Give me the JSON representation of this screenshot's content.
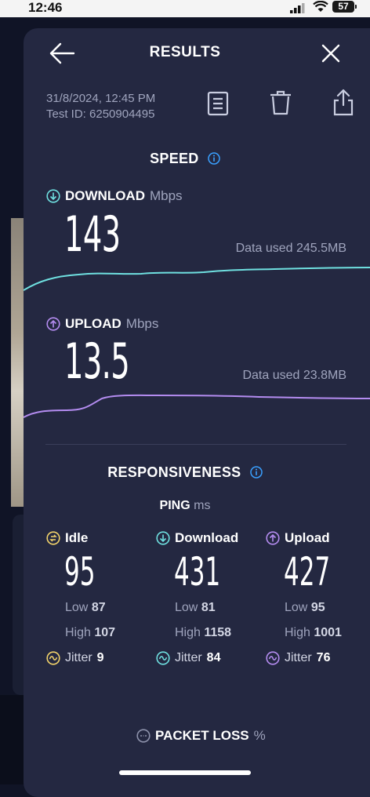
{
  "status": {
    "time": "12:46",
    "battery": "57"
  },
  "header": {
    "title": "RESULTS"
  },
  "meta": {
    "datetime": "31/8/2024, 12:45 PM",
    "test_id": "Test ID: 6250904495"
  },
  "speed": {
    "title": "SPEED",
    "download": {
      "label": "DOWNLOAD",
      "unit": "Mbps",
      "value": "143",
      "data_used": "Data used 245.5MB"
    },
    "upload": {
      "label": "UPLOAD",
      "unit": "Mbps",
      "value": "13.5",
      "data_used": "Data used 23.8MB"
    }
  },
  "responsiveness": {
    "title": "RESPONSIVENESS",
    "ping_label": "PING",
    "ping_unit": "ms",
    "low_label": "Low",
    "high_label": "High",
    "jitter_label": "Jitter",
    "idle": {
      "label": "Idle",
      "value": "95",
      "low": "87",
      "high": "107",
      "jitter": "9"
    },
    "download": {
      "label": "Download",
      "value": "431",
      "low": "81",
      "high": "1158",
      "jitter": "84"
    },
    "upload": {
      "label": "Upload",
      "value": "427",
      "low": "95",
      "high": "1001",
      "jitter": "76"
    }
  },
  "packet_loss": {
    "label": "PACKET LOSS",
    "unit": "%"
  },
  "colors": {
    "download": "#6fe0e0",
    "upload": "#b48cf0",
    "idle": "#f2d36b",
    "info": "#3aa0ff"
  },
  "icons": [
    "back-arrow-icon",
    "close-icon",
    "report-icon",
    "trash-icon",
    "share-icon",
    "info-icon",
    "download-arrow-icon",
    "upload-arrow-icon",
    "idle-icon",
    "jitter-icon",
    "packet-loss-icon"
  ]
}
